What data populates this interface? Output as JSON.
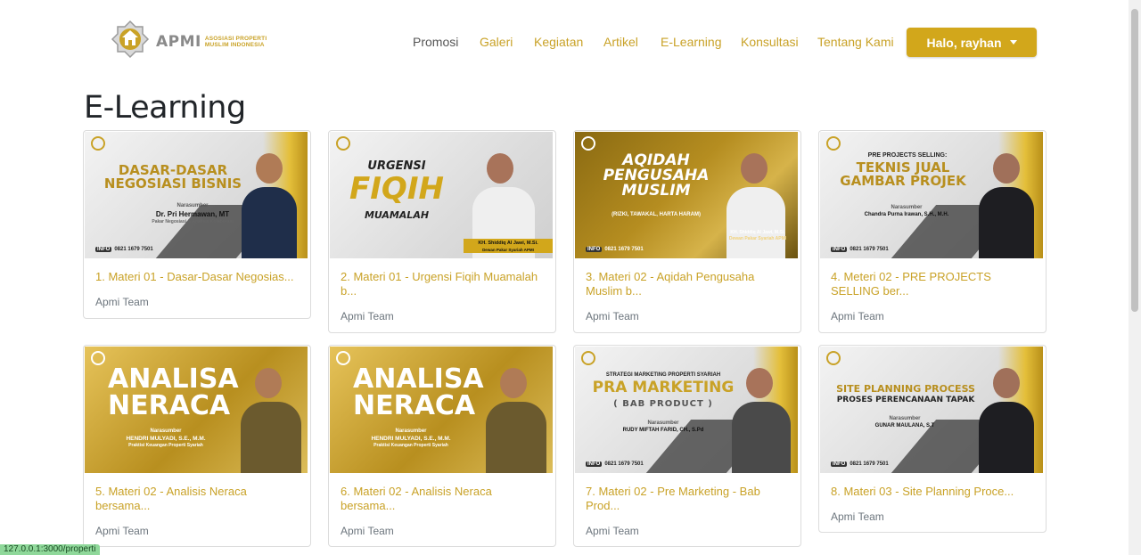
{
  "brand": {
    "name": "APMI",
    "sub_line1": "ASOSIASI PROPERTI",
    "sub_line2": "MUSLIM INDONESIA"
  },
  "nav": {
    "items": [
      "Promosi",
      "Galeri",
      "Kegiatan",
      "Artikel",
      "E-Learning",
      "Konsultasi",
      "Tentang Kami"
    ],
    "active": "Promosi",
    "user_label": "Halo, rayhan"
  },
  "page": {
    "title": "E-Learning"
  },
  "colors": {
    "accent": "#d2a71b",
    "link_gold": "#c9a227",
    "muted": "#6c757d"
  },
  "cards": [
    {
      "title": "1. Materi 01 - Dasar-Dasar Negosias...",
      "author": "Apmi Team",
      "image": {
        "headline1": "DASAR-DASAR",
        "headline2": "NEGOSIASI BISNIS",
        "speaker_label": "Narasumber",
        "speaker": "Dr. Pri Hermawan, MT",
        "role": "Pakar Negosiasi & Analisis Kolaborasi",
        "info": "0821 1679 7501"
      }
    },
    {
      "title": "2. Materi 01 - Urgensi Fiqih Muamalah b...",
      "author": "Apmi Team",
      "image": {
        "headline1": "URGENSI",
        "headline2": "FIQIH",
        "headline3": "MUAMALAH",
        "speaker": "KH. Shiddiq Al Jawi, M.Si.",
        "role": "Dewan Pakar Syariah APMI"
      }
    },
    {
      "title": "3. Materi 02 - Aqidah Pengusaha Muslim b...",
      "author": "Apmi Team",
      "image": {
        "headline1": "AQIDAH",
        "headline2": "PENGUSAHA",
        "headline3": "MUSLIM",
        "sub": "(RIZKI, TAWAKAL, HARTA HARAM)",
        "speaker": "KH. Shiddiq Al Jawi, M.Si.",
        "role": "Dewan Pakar Syariah APMI",
        "info": "0821 1679 7501"
      }
    },
    {
      "title": "4. Meteri 02 - PRE PROJECTS SELLING ber...",
      "author": "Apmi Team",
      "image": {
        "headline0": "PRE PROJECTS SELLING:",
        "headline1": "TEKNIS JUAL",
        "headline2": "GAMBAR PROJEK",
        "speaker_label": "Narasumber",
        "speaker": "Chandra Purna Irawan, S.H., M.H.",
        "info": "0821 1679 7501"
      }
    },
    {
      "title": "5. Materi 02 - Analisis Neraca bersama...",
      "author": "Apmi Team",
      "image": {
        "headline1": "ANALISA",
        "headline2": "NERACA",
        "speaker_label": "Narasumber",
        "speaker": "HENDRI MULYADI, S.E., M.M.",
        "role": "Praktisi Keuangan Properti Syariah"
      }
    },
    {
      "title": "6. Materi 02 - Analisis Neraca bersama...",
      "author": "Apmi Team",
      "image": {
        "headline1": "ANALISA",
        "headline2": "NERACA",
        "speaker_label": "Narasumber",
        "speaker": "HENDRI MULYADI, S.E., M.M.",
        "role": "Praktisi Keuangan Properti Syariah"
      }
    },
    {
      "title": "7. Materi 02 - Pre Marketing - Bab Prod...",
      "author": "Apmi Team",
      "image": {
        "headline0": "STRATEGI MARKETING PROPERTI SYARIAH",
        "headline1": "PRA MARKETING",
        "headline2": "( BAB PRODUCT )",
        "speaker_label": "Narasumber",
        "speaker": "RUDY MIFTAH FARID, CH., S.Pd",
        "info": "0821 1679 7501"
      }
    },
    {
      "title": "8. Materi 03 - Site Planning Proce...",
      "author": "Apmi Team",
      "image": {
        "headline1": "SITE PLANNING PROCESS",
        "headline2": "PROSES PERENCANAAN TAPAK",
        "speaker_label": "Narasumber",
        "speaker": "GUNAR MAULANA, S.T",
        "info": "0821 1679 7501"
      }
    }
  ],
  "status_bar": {
    "text": "127.0.0.1:3000/properti"
  }
}
